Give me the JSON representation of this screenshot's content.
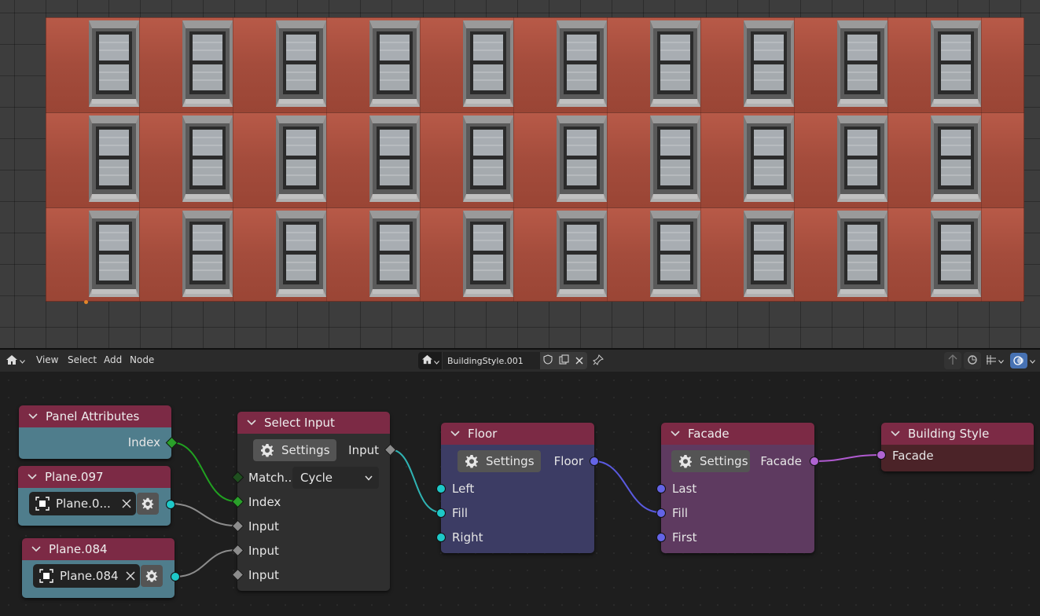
{
  "header": {
    "menus": [
      "View",
      "Select",
      "Add",
      "Node"
    ],
    "node_tree_name": "BuildingStyle.001"
  },
  "nodes": {
    "panel_attributes": {
      "title": "Panel Attributes",
      "output": "Index"
    },
    "plane097": {
      "title": "Plane.097",
      "object": "Plane.0..."
    },
    "plane084": {
      "title": "Plane.084",
      "object": "Plane.084"
    },
    "select_input": {
      "title": "Select Input",
      "settings": "Settings",
      "output": "Input",
      "match_label": "Match...",
      "match_value": "Cycle",
      "inputs": [
        "Index",
        "Input",
        "Input",
        "Input"
      ]
    },
    "floor": {
      "title": "Floor",
      "settings": "Settings",
      "output": "Floor",
      "inputs": [
        "Left",
        "Fill",
        "Right"
      ]
    },
    "facade": {
      "title": "Facade",
      "settings": "Settings",
      "output": "Facade",
      "inputs": [
        "Last",
        "Fill",
        "First"
      ]
    },
    "building_style": {
      "title": "Building Style",
      "input": "Facade"
    }
  },
  "colors": {
    "node_header": "#7c2a45",
    "object_node_body": "#4f7d8c",
    "floor_body": "#3c3c64",
    "facade_body": "#5e3a60",
    "output_body": "#4b2328",
    "select_body": "#2f2f2f",
    "socket_teal": "#1ec8c8",
    "socket_blue": "#6464e6",
    "socket_purple": "#b064d2",
    "socket_green": "#2aa02a",
    "link_green": "#21a121",
    "link_teal": "#2fb3b3",
    "link_blue": "#5a5ae0",
    "link_purple": "#b05ad0"
  },
  "icons": [
    "home-icon",
    "pin-icon",
    "shield-icon",
    "duplicate-icon",
    "close-icon",
    "gear-icon",
    "object-icon",
    "overlay-icon",
    "snap-icon"
  ]
}
